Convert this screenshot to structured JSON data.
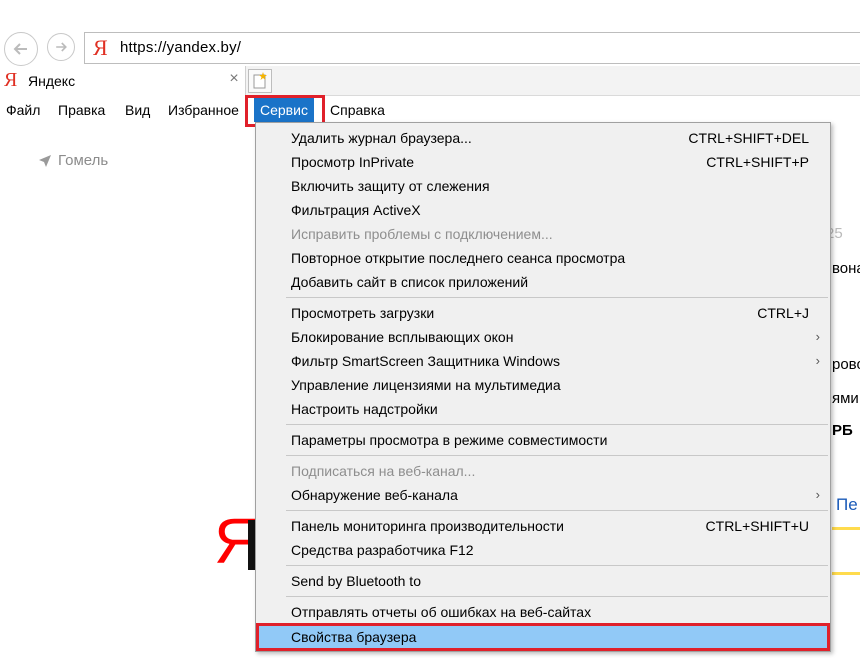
{
  "address_bar": {
    "logo": "Я",
    "url": "https://yandex.by/"
  },
  "tab": {
    "favicon": "Я",
    "title": "Яндекс",
    "close": "×"
  },
  "menubar": {
    "file": "Файл",
    "edit": "Правка",
    "view": "Вид",
    "favorites": "Избранное",
    "tools": "Сервис",
    "help": "Справка"
  },
  "page": {
    "location": "Гомель",
    "logo": "Я",
    "fragments": [
      "25",
      "вона",
      "рово",
      "ями",
      "РБ",
      "Пе"
    ]
  },
  "dropdown": {
    "items": [
      {
        "label": "Удалить журнал браузера...",
        "shortcut": "CTRL+SHIFT+DEL"
      },
      {
        "label": "Просмотр InPrivate",
        "shortcut": "CTRL+SHIFT+P"
      },
      {
        "label": "Включить защиту от слежения",
        "shortcut": ""
      },
      {
        "label": "Фильтрация ActiveX",
        "shortcut": ""
      },
      {
        "label": "Исправить проблемы с подключением...",
        "shortcut": "",
        "disabled": true
      },
      {
        "label": "Повторное открытие последнего сеанса просмотра",
        "shortcut": ""
      },
      {
        "label": "Добавить сайт в список приложений",
        "shortcut": ""
      },
      {
        "label": "Просмотреть загрузки",
        "shortcut": "CTRL+J"
      },
      {
        "label": "Блокирование всплывающих окон",
        "shortcut": "",
        "submenu": true
      },
      {
        "label": "Фильтр SmartScreen Защитника Windows",
        "shortcut": "",
        "submenu": true
      },
      {
        "label": "Управление лицензиями на мультимедиа",
        "shortcut": ""
      },
      {
        "label": "Настроить надстройки",
        "shortcut": ""
      },
      {
        "label": "Параметры просмотра в режиме совместимости",
        "shortcut": ""
      },
      {
        "label": "Подписаться на веб-канал...",
        "shortcut": "",
        "disabled": true
      },
      {
        "label": "Обнаружение веб-канала",
        "shortcut": "",
        "submenu": true
      },
      {
        "label": "Панель мониторинга производительности",
        "shortcut": "CTRL+SHIFT+U"
      },
      {
        "label": "Средства разработчика F12",
        "shortcut": ""
      },
      {
        "label": "Send by Bluetooth to",
        "shortcut": ""
      },
      {
        "label": "Отправлять отчеты об ошибках на веб-сайтах",
        "shortcut": ""
      },
      {
        "label": "Свойства браузера",
        "shortcut": "",
        "selected": true
      }
    ],
    "submenu_arrow": "›"
  },
  "colors": {
    "accent": "#1a73c8",
    "highlight_border": "#e0202a",
    "selected_item": "#91c9f7",
    "logo_red": "#ff0000"
  }
}
